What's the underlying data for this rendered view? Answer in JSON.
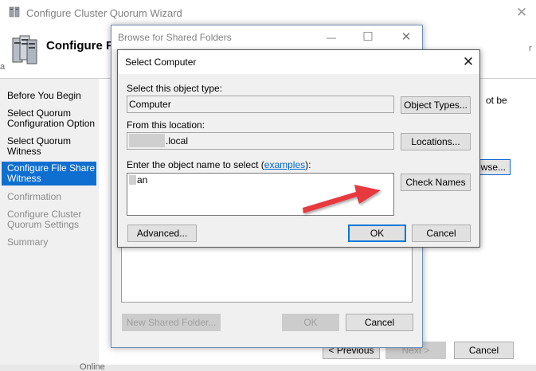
{
  "wizard": {
    "title": "Configure Cluster Quorum Wizard",
    "close_glyph": "✕",
    "header_title": "Configure F",
    "edge_char_left": "a",
    "edge_char_right": "r",
    "nav": [
      {
        "label": "Before You Begin",
        "state": "done"
      },
      {
        "label": "Select Quorum Configuration Option",
        "state": "done"
      },
      {
        "label": "Select Quorum Witness",
        "state": "done"
      },
      {
        "label": "Configure File Share Witness",
        "state": "active"
      },
      {
        "label": "Confirmation",
        "state": "disabled"
      },
      {
        "label": "Configure Cluster Quorum Settings",
        "state": "disabled"
      },
      {
        "label": "Summary",
        "state": "disabled"
      }
    ],
    "right_text": "ot be",
    "browse_button": "owse...",
    "previous_button": "< Previous",
    "next_button": "Next >",
    "cancel_button": "Cancel",
    "bottom_fragment": "Online"
  },
  "browse_dialog": {
    "title": "Browse for Shared Folders",
    "minimize_glyph": "—",
    "maximize_glyph": "☐",
    "close_glyph": "✕",
    "new_folder_button": "New Shared Folder...",
    "ok_button": "OK",
    "cancel_button": "Cancel"
  },
  "select_computer": {
    "title": "Select Computer",
    "close_glyph": "✕",
    "object_type_label": "Select this object type:",
    "object_type_value": "Computer",
    "object_types_button": "Object Types...",
    "location_label": "From this location:",
    "location_value": ".local",
    "locations_button": "Locations...",
    "name_label_prefix": "Enter the object name to select (",
    "name_label_link": "examples",
    "name_label_suffix": "):",
    "name_value": "an",
    "check_names_button": "Check Names",
    "advanced_button": "Advanced...",
    "ok_button": "OK",
    "cancel_button": "Cancel"
  },
  "annotation": {
    "arrow_color": "#e8373f"
  }
}
